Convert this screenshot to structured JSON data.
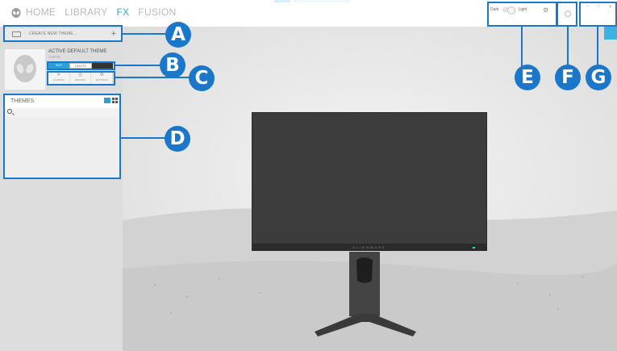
{
  "nav": {
    "items": [
      "HOME",
      "LIBRARY",
      "FX",
      "FUSION"
    ],
    "active_index": 2
  },
  "theme_mode": {
    "dark_label": "Dark",
    "light_label": "Light"
  },
  "left": {
    "create_label": "CREATE NEW THEME...",
    "create_plus": "+",
    "active_theme_title": "ACTIVE DEFAULT THEME",
    "active_theme_sub": "T-MPSE",
    "actions": [
      "EDIT",
      "DELETE",
      ""
    ],
    "tabs": [
      {
        "icon": "lighting-icon",
        "glyph": "☀",
        "label": "LIGHTING"
      },
      {
        "icon": "macros-icon",
        "glyph": "◎",
        "label": "MACROS"
      },
      {
        "icon": "settings-icon",
        "glyph": "⚙",
        "label": "SETTINGS"
      }
    ],
    "themes_title": "THEMES"
  },
  "monitor": {
    "brand": "ALIENWARE"
  },
  "callouts": [
    "A",
    "B",
    "C",
    "D",
    "E",
    "F",
    "G"
  ],
  "colors": {
    "accent": "#2aa6d9",
    "callout": "#1a77c9"
  }
}
